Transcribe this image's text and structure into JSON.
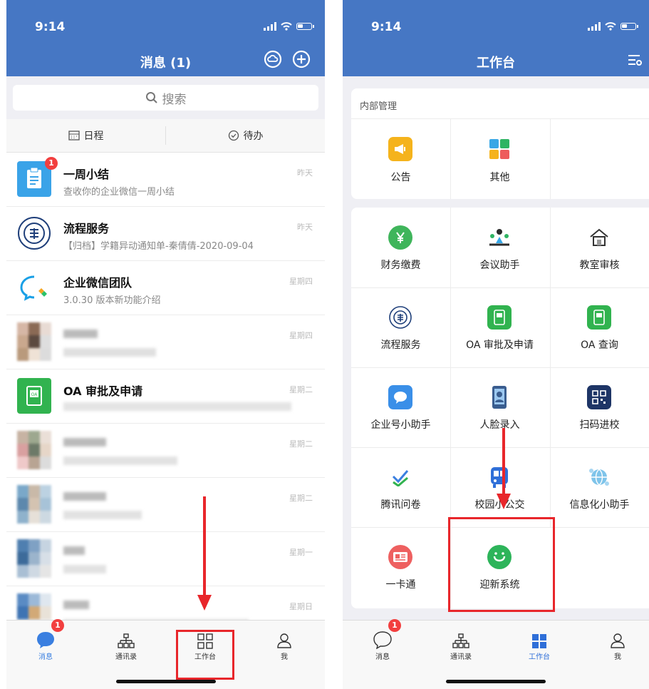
{
  "status": {
    "time": "9:14"
  },
  "left": {
    "title": "消息 (1)",
    "search_placeholder": "搜索",
    "tabs": [
      {
        "label": "日程",
        "icon": "calendar-icon"
      },
      {
        "label": "待办",
        "icon": "check-circle-icon"
      }
    ],
    "messages": [
      {
        "title": "一周小结",
        "subtitle": "查收你的企业微信一周小结",
        "time": "昨天",
        "badge": "1"
      },
      {
        "title": "流程服务",
        "subtitle": "【归档】学籍异动通知单-秦倩倩-2020-09-04",
        "time": "昨天"
      },
      {
        "title": "企业微信团队",
        "subtitle": "3.0.30 版本新功能介绍",
        "time": "星期四"
      },
      {
        "title": "",
        "subtitle": "",
        "time": "星期四"
      },
      {
        "title": "OA 审批及申请",
        "subtitle": "",
        "time": "星期二"
      },
      {
        "title": "",
        "subtitle": "",
        "time": "星期二"
      },
      {
        "title": "",
        "subtitle": "",
        "time": "星期二"
      },
      {
        "title": "",
        "subtitle": "",
        "time": "星期一"
      },
      {
        "title": "",
        "subtitle": "",
        "time": "星期日"
      }
    ],
    "tabbar": [
      {
        "label": "消息",
        "badge": "1",
        "active": true
      },
      {
        "label": "通讯录"
      },
      {
        "label": "工作台"
      },
      {
        "label": "我"
      }
    ]
  },
  "right": {
    "title": "工作台",
    "section1_title": "内部管理",
    "section1_items": [
      {
        "label": "公告",
        "icon": "megaphone-icon"
      },
      {
        "label": "其他",
        "icon": "apps-icon"
      }
    ],
    "section2_items": [
      {
        "label": "财务缴费",
        "icon": "yuan-icon"
      },
      {
        "label": "会议助手",
        "icon": "meeting-icon"
      },
      {
        "label": "教室审核",
        "icon": "building-icon"
      },
      {
        "label": "流程服务",
        "icon": "university-seal-icon"
      },
      {
        "label": "OA 审批及申请",
        "icon": "oa-icon"
      },
      {
        "label": "OA 查询",
        "icon": "oa-query-icon"
      },
      {
        "label": "企业号小助手",
        "icon": "chat-bubble-icon"
      },
      {
        "label": "人脸录入",
        "icon": "face-scan-icon"
      },
      {
        "label": "扫码进校",
        "icon": "qr-code-icon"
      },
      {
        "label": "腾讯问卷",
        "icon": "survey-check-icon"
      },
      {
        "label": "校园小公交",
        "icon": "bus-icon"
      },
      {
        "label": "信息化小助手",
        "icon": "globe-icon"
      },
      {
        "label": "一卡通",
        "icon": "id-card-icon"
      },
      {
        "label": "迎新系统",
        "icon": "welcome-smile-icon"
      }
    ],
    "tabbar": [
      {
        "label": "消息",
        "badge": "1"
      },
      {
        "label": "通讯录"
      },
      {
        "label": "工作台",
        "active": true
      },
      {
        "label": "我"
      }
    ]
  },
  "colors": {
    "header_blue": "#4677c4",
    "badge_red": "#f23f3f",
    "annotation_red": "#e8262b"
  }
}
